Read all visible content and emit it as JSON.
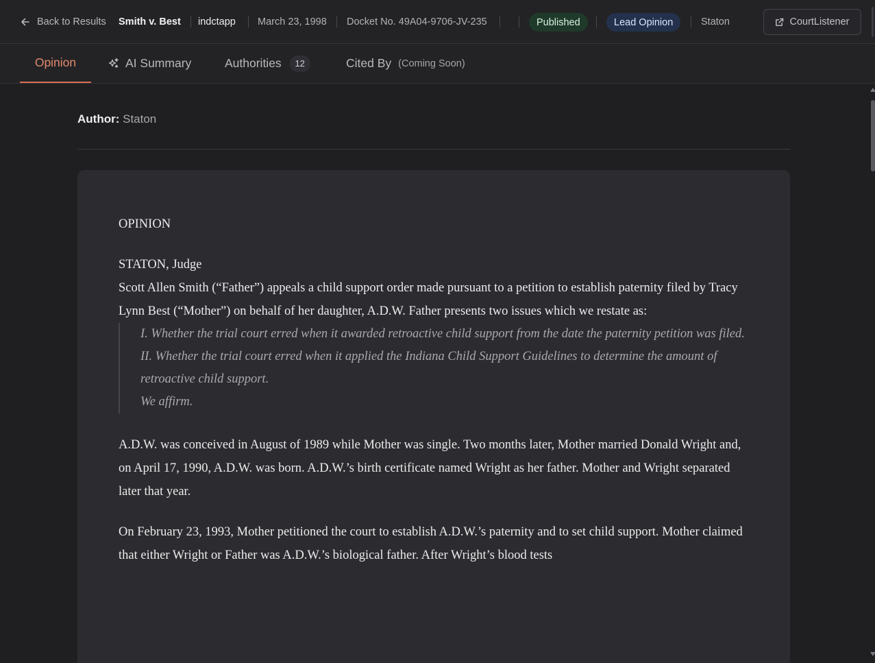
{
  "header": {
    "back_label": "Back to Results",
    "case_title": "Smith v. Best",
    "court": "indctapp",
    "date": "March 23, 1998",
    "docket": "Docket No. 49A04-9706-JV-235",
    "status_badge": "Published",
    "opinion_type_badge": "Lead Opinion",
    "author": "Staton",
    "courtlistener_label": "CourtListener"
  },
  "tabs": {
    "opinion": "Opinion",
    "ai_summary": "AI Summary",
    "authorities": "Authorities",
    "authorities_count": "12",
    "cited_by": "Cited By",
    "cited_by_note": "(Coming Soon)"
  },
  "opinion": {
    "author_label": "Author:",
    "author_value": "Staton",
    "heading": "OPINION",
    "judge": "STATON, Judge",
    "intro": "Scott Allen Smith (“Father”) appeals a child support order made pursuant to a petition to establish paternity filed by Tracy Lynn Best (“Mother”) on behalf of her daughter, A.D.W. Father presents two issues which we restate as:",
    "issue_1": "I. Whether the trial court erred when it awarded retroactive child support from the date the paternity petition was filed.",
    "issue_2": "II. Whether the trial court erred when it applied the Indiana Child Support Guidelines to determine the amount of retroactive child support.",
    "holding": "We affirm.",
    "para_1": "A.D.W. was conceived in August of 1989 while Mother was single. Two months later, Mother married Donald Wright and, on April 17, 1990, A.D.W. was born. A.D.W.’s birth certificate named Wright as her father. Mother and Wright separated later that year.",
    "para_2": "On February 23, 1993, Mother petitioned the court to establish A.D.W.’s paternity and to set child support. Mother claimed that either Wright or Father was A.D.W.’s biological father. After Wright’s blood tests"
  }
}
